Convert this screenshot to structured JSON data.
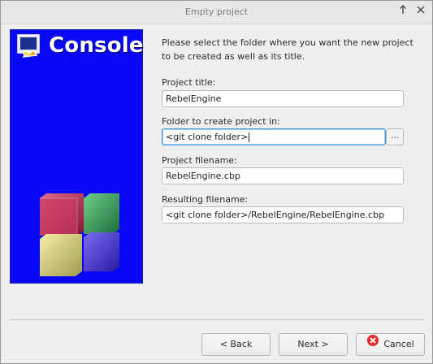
{
  "window": {
    "title": "Empty project"
  },
  "banner": {
    "title": "Console"
  },
  "intro": "Please select the folder where you want the new project to be created as well as its title.",
  "fields": {
    "project_title": {
      "label": "Project title:",
      "value": "RebelEngine"
    },
    "folder": {
      "label": "Folder to create project in:",
      "value": "<git clone folder>",
      "browse_label": "..."
    },
    "project_filename": {
      "label": "Project filename:",
      "value": "RebelEngine.cbp"
    },
    "resulting_filename": {
      "label": "Resulting filename:",
      "value": "<git clone folder>/RebelEngine/RebelEngine.cbp"
    }
  },
  "buttons": {
    "back": "< Back",
    "next": "Next >",
    "cancel": "Cancel"
  },
  "titlebar_icons": {
    "pin": "pin-icon",
    "close": "close-icon"
  },
  "colors": {
    "banner": "#0808f5",
    "focus": "#4c9ce3",
    "cancel_icon": "#e52b2b"
  }
}
